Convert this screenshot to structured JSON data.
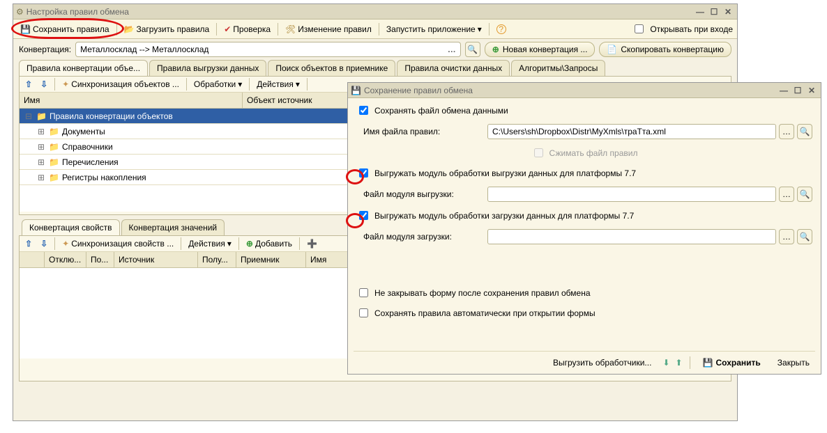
{
  "main": {
    "title": "Настройка правил обмена",
    "toolbar": {
      "save": "Сохранить правила",
      "load": "Загрузить правила",
      "check": "Проверка",
      "modify": "Изменение правил",
      "run": "Запустить приложение",
      "openOnEnter": "Открывать при входе"
    },
    "conv": {
      "label": "Конвертация:",
      "value": "Металлосклад --> Металлосклад",
      "newBtn": "Новая конвертация ...",
      "copyBtn": "Скопировать конвертацию"
    },
    "tabs": [
      "Правила конвертации объе...",
      "Правила выгрузки данных",
      "Поиск объектов в приемнике",
      "Правила очистки данных",
      "Алгоритмы\\Запросы"
    ],
    "subtool": {
      "sync": "Синхронизация объектов ...",
      "proc": "Обработки",
      "actions": "Действия"
    },
    "grid": {
      "headers": [
        "Имя",
        "Объект источник"
      ],
      "root": "Правила конвертации объектов",
      "children": [
        "Документы",
        "Справочники",
        "Перечисления",
        "Регистры накопления"
      ]
    },
    "subTabs": [
      "Конвертация свойств",
      "Конвертация значений"
    ],
    "subtool2": {
      "sync": "Синхронизация свойств ...",
      "actions": "Действия",
      "add": "Добавить"
    },
    "grid2Headers": [
      "",
      "Отклю...",
      "По...",
      "Источник",
      "Полу...",
      "Приемник",
      "Имя"
    ]
  },
  "dialog": {
    "title": "Сохранение правил обмена",
    "saveFile": "Сохранять файл обмена данными",
    "fileNameLabel": "Имя файла правил:",
    "fileNameValue": "C:\\Users\\sh\\Dropbox\\Distr\\MyXmls\\траТта.xml",
    "compress": "Сжимать файл правил",
    "exportUpload77": "Выгружать модуль обработки выгрузки данных для платформы 7.7",
    "uploadModuleLabel": "Файл модуля выгрузки:",
    "exportDownload77": "Выгружать модуль обработки загрузки данных для платформы 7.7",
    "downloadModuleLabel": "Файл модуля загрузки:",
    "dontClose": "Не закрывать форму после сохранения правил обмена",
    "autoSave": "Сохранять правила автоматически при открытии формы",
    "footer": {
      "exportHandlers": "Выгрузить обработчики...",
      "save": "Сохранить",
      "close": "Закрыть"
    }
  }
}
